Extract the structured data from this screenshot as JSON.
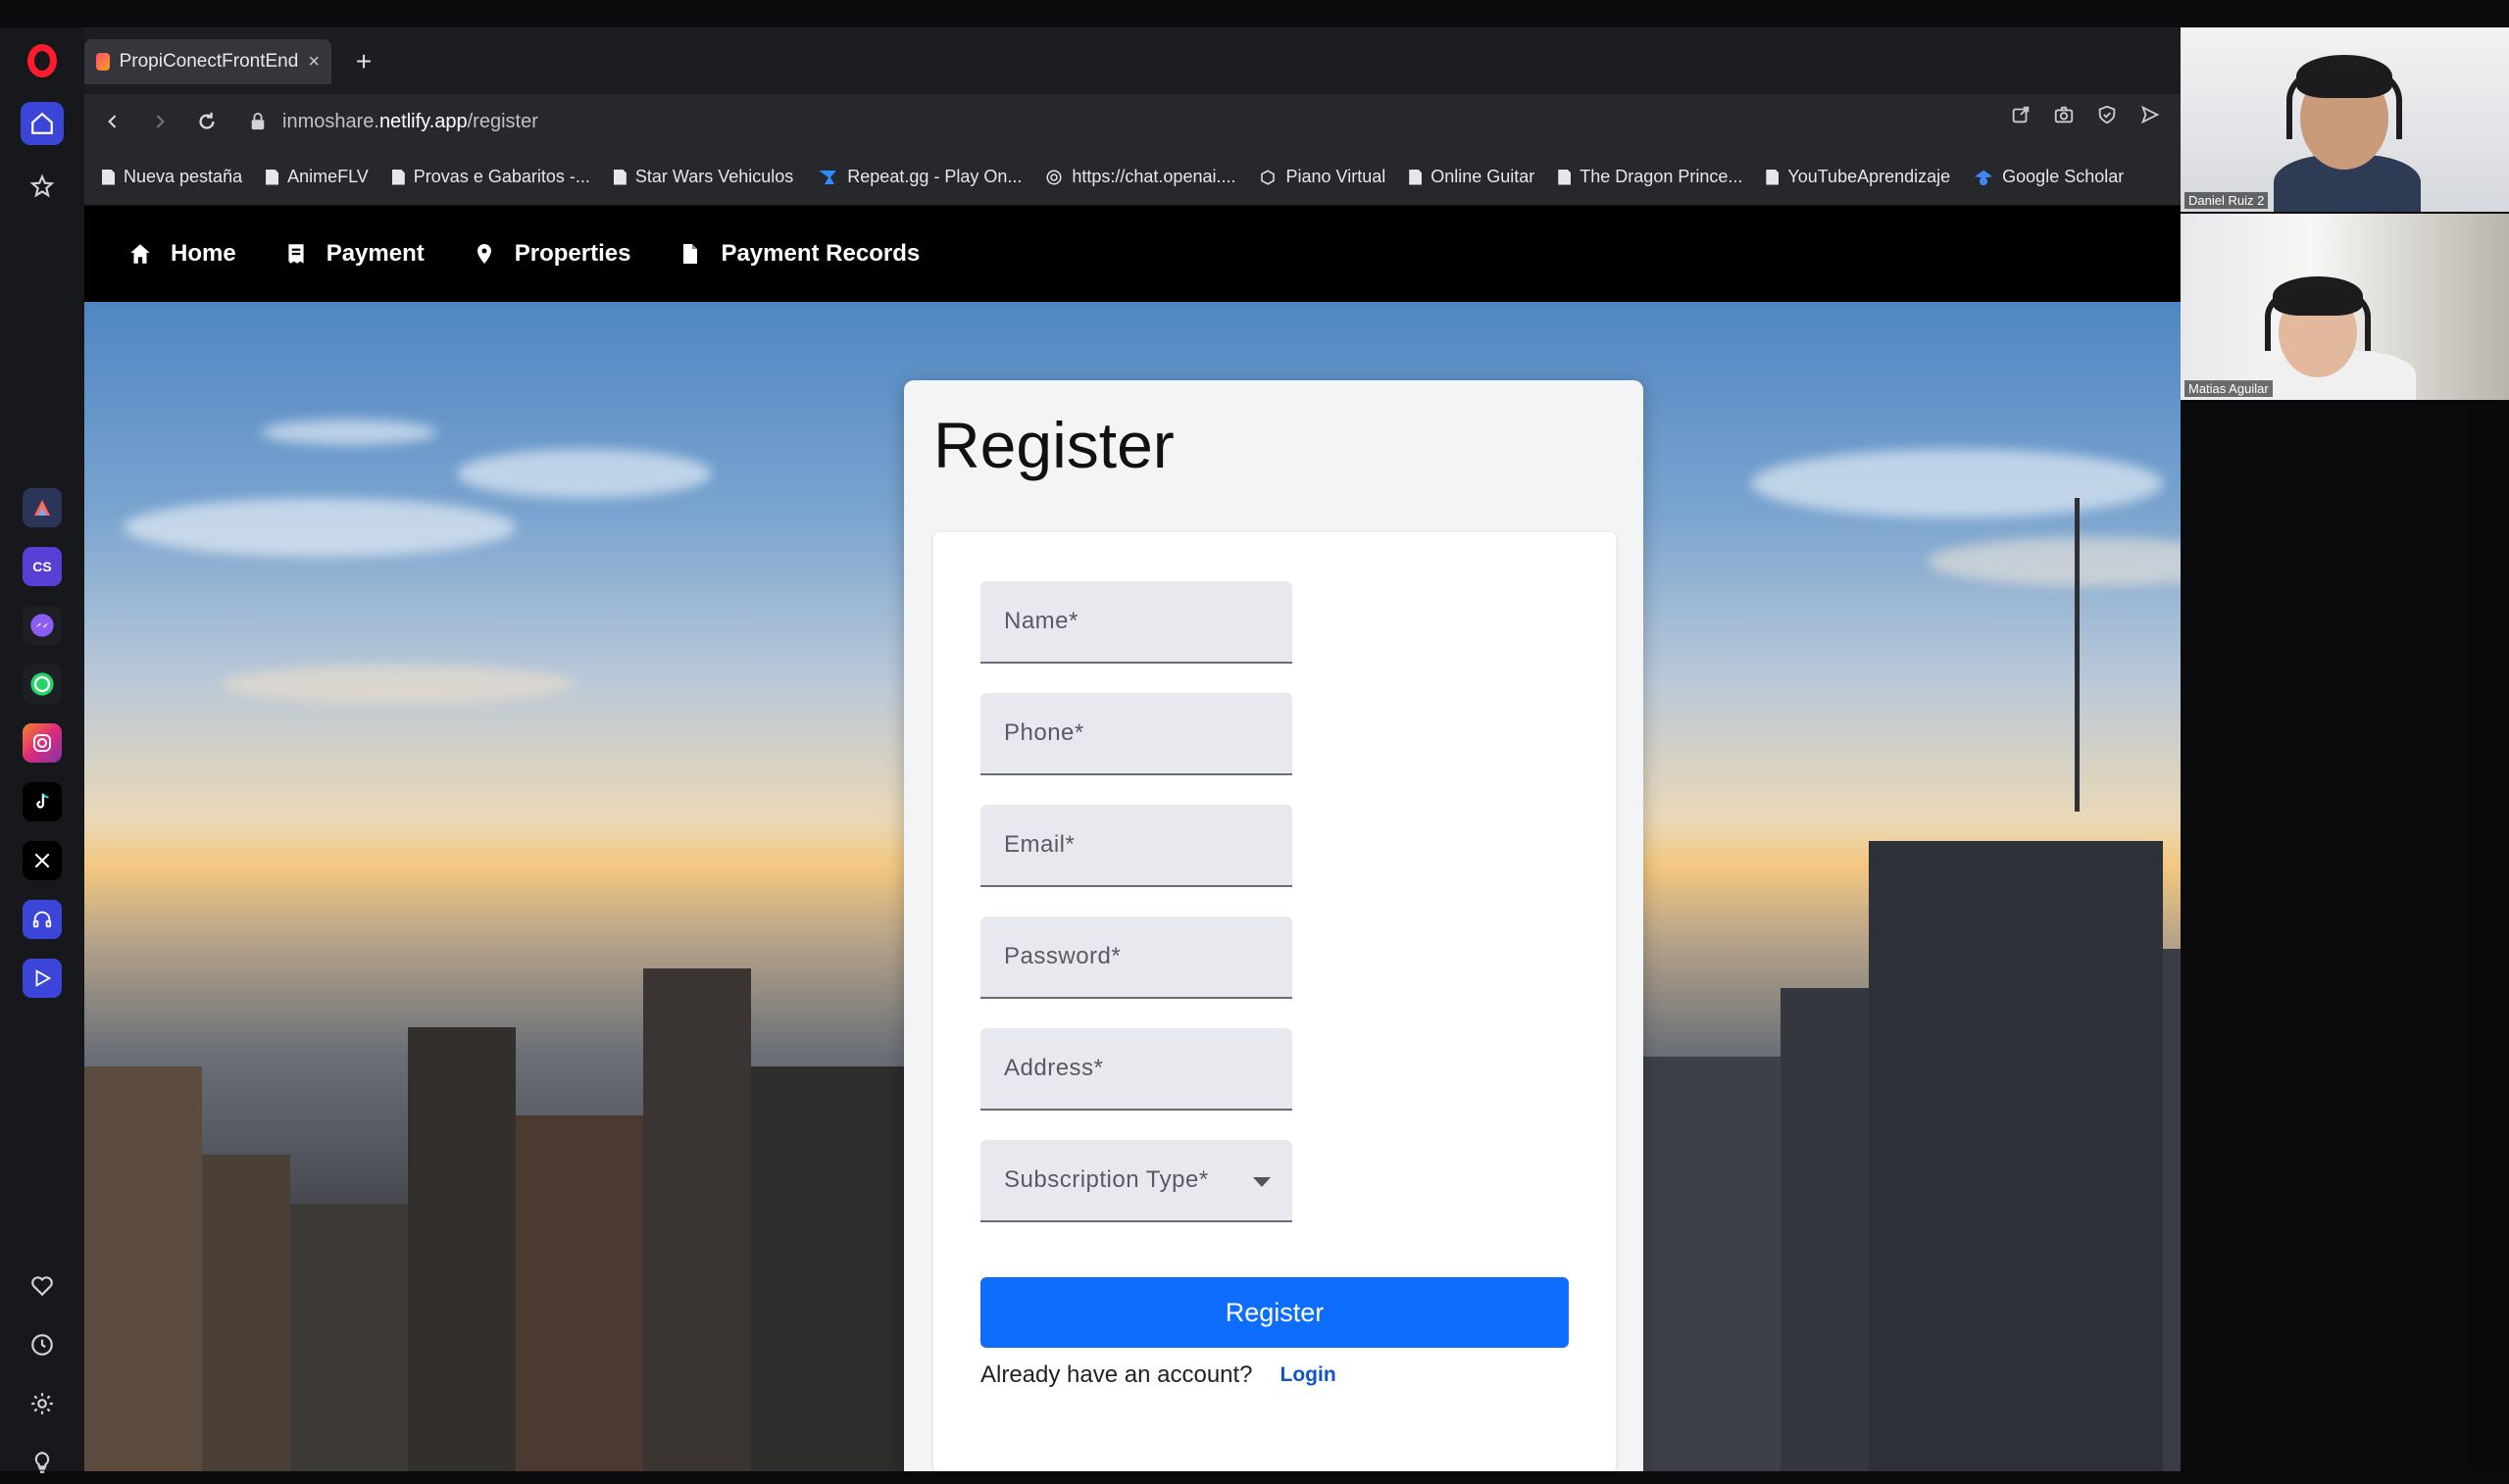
{
  "browser": {
    "tab_title": "PropiConectFrontEnd",
    "url_prefix": "inmoshare.",
    "url_host": "netlify.app",
    "url_path": "/register",
    "bookmarks": [
      "Nueva pestaña",
      "AnimeFLV",
      "Provas e Gabaritos -...",
      "Star Wars Vehiculos",
      "Repeat.gg - Play On...",
      "https://chat.openai....",
      "Piano Virtual",
      "Online Guitar",
      "The Dragon Prince...",
      "YouTubeAprendizaje",
      "Google Scholar"
    ]
  },
  "site_nav": {
    "home": "Home",
    "payment": "Payment",
    "properties": "Properties",
    "payment_records": "Payment Records"
  },
  "form": {
    "title": "Register",
    "name_label": "Name*",
    "phone_label": "Phone*",
    "email_label": "Email*",
    "password_label": "Password*",
    "address_label": "Address*",
    "subscription_label": "Subscription Type*",
    "submit_label": "Register",
    "login_question": "Already have an account?",
    "login_link": "Login"
  },
  "video_call": {
    "participant_1": "Daniel Ruiz 2",
    "participant_2": "Matias Aguilar"
  },
  "sidebar_apps": [
    "CS"
  ],
  "colors": {
    "primary_button": "#0d6efd",
    "opera_red": "#ff1b2d",
    "sidebar_active": "#3b46d9"
  }
}
